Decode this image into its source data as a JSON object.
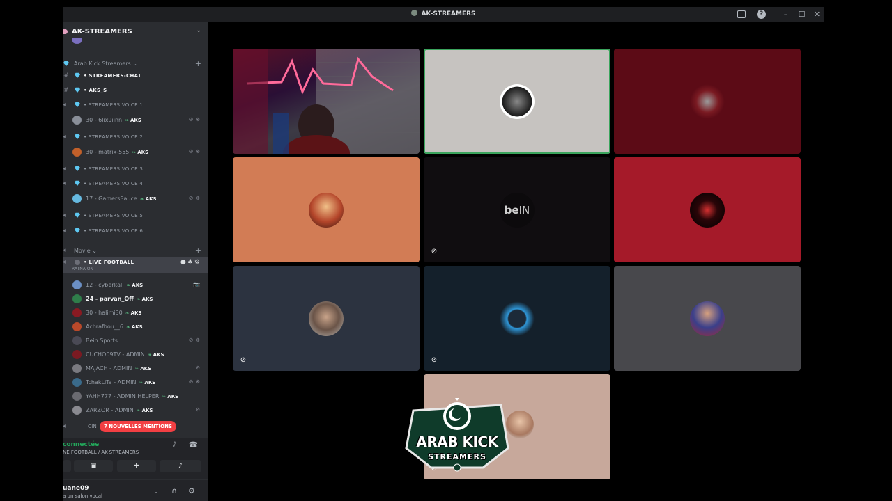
{
  "window": {
    "title": "AK-STREAMERS"
  },
  "server": {
    "name": "AK-STREAMERS"
  },
  "categories": [
    {
      "label": "Arab Kick Streamers"
    },
    {
      "label": "Movie"
    }
  ],
  "channels": {
    "streamers_chat": "STREAMERS-CHAT",
    "aks_s": "AKS_S",
    "voice1": "STREAMERS VOICE 1",
    "voice2": "STREAMERS VOICE 2",
    "voice3": "STREAMERS VOICE 3",
    "voice4": "STREAMERS VOICE 4",
    "voice5": "STREAMERS VOICE 5",
    "voice6": "STREAMERS VOICE 6",
    "live_football": "LIVE FOOTBALL",
    "live_football_status": "RATNA ON",
    "cut_channel": "CIN"
  },
  "tag": "AKS",
  "voice_users": {
    "v1": "30 - 6lix9iinn",
    "v2": "30 - matrix-555",
    "v4": "17 - GamersSauce"
  },
  "live_users": [
    {
      "name": "12 - cyberkall",
      "tag": "AKS"
    },
    {
      "name": "24 - parvan_Off",
      "tag": "AKS"
    },
    {
      "name": "30 - halimi30",
      "tag": "AKS"
    },
    {
      "name": "Achrafbou__6",
      "tag": "AKS"
    },
    {
      "name": "Bein Sports",
      "tag": ""
    },
    {
      "name": "CUCHO09TV - ADMIN",
      "tag": "AKS"
    },
    {
      "name": "MAJACH - ADMIN",
      "tag": "AKS"
    },
    {
      "name": "TchakLiTa - ADMIN",
      "tag": "AKS"
    },
    {
      "name": "YAHH777 - ADMIN HELPER",
      "tag": "AKS"
    },
    {
      "name": "ZARZOR - ADMIN",
      "tag": "AKS"
    }
  ],
  "mentions_badge": "7 NOUVELLES MENTIONS",
  "voice_panel": {
    "status": "connectée",
    "location": "NE FOOTBALL / AK-STREAMERS"
  },
  "user_panel": {
    "username": "uane09",
    "status": "a un salon vocal"
  },
  "overlay": {
    "title": "ARAB KICK",
    "subtitle": "STREAMERS"
  },
  "icons": {
    "channel": "diamond-icon",
    "mute": "mic-muted-icon",
    "deafen": "headphones-muted-icon"
  },
  "colors": {
    "sidebar": "#2b2d31",
    "speaking": "#3ba55d",
    "mentions": "#f23f43",
    "tile_peach": "#d27c55",
    "tile_red": "#a51a29",
    "tile_darkred": "#5c0b16",
    "tile_grey": "#c6c3c0",
    "tile_slate": "#2c3340",
    "tile_navy": "#14202b",
    "tile_ash": "#48484c",
    "tile_black": "#100d10",
    "tile_beige": "#c7a89b"
  }
}
